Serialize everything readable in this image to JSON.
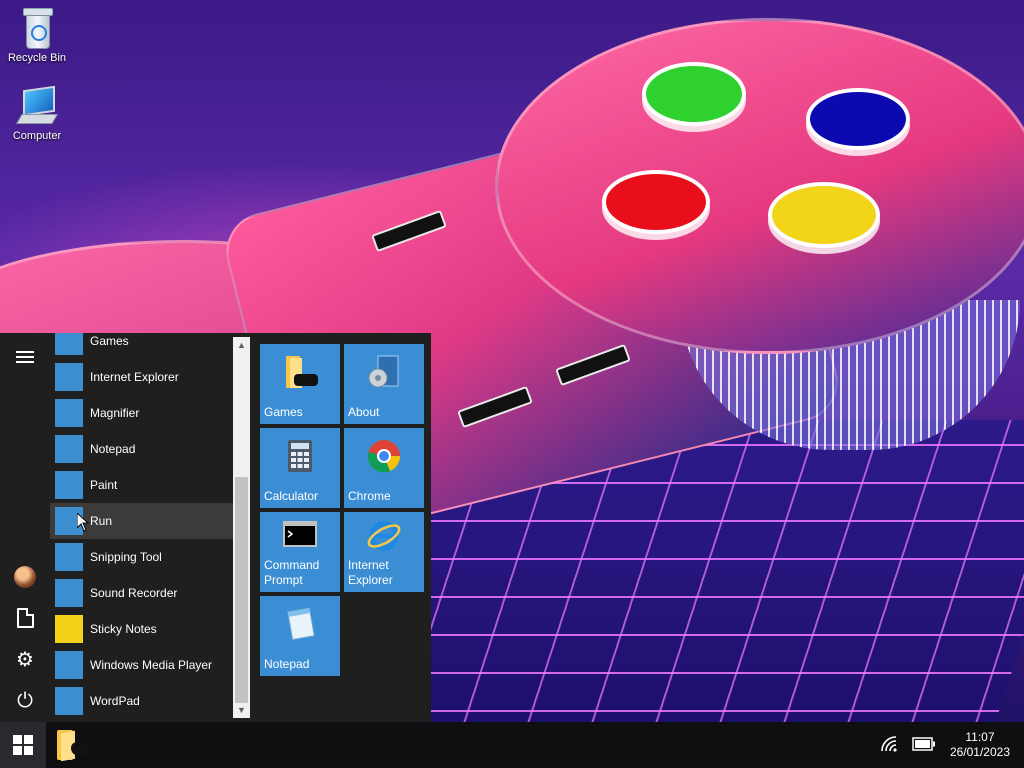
{
  "desktop": {
    "icons": [
      {
        "label": "Recycle Bin",
        "icon": "recycle-bin-icon"
      },
      {
        "label": "Computer",
        "icon": "computer-icon"
      }
    ]
  },
  "start_menu": {
    "rail": [
      {
        "name": "menu",
        "icon": "hamburger-icon"
      },
      {
        "name": "user",
        "icon": "user-avatar"
      },
      {
        "name": "documents",
        "icon": "document-icon"
      },
      {
        "name": "settings",
        "icon": "gear-icon"
      },
      {
        "name": "power",
        "icon": "power-icon"
      }
    ],
    "apps": [
      {
        "label": "Games",
        "icon": "games-folder-icon"
      },
      {
        "label": "Internet Explorer",
        "icon": "internet-explorer-icon"
      },
      {
        "label": "Magnifier",
        "icon": "magnifier-icon"
      },
      {
        "label": "Notepad",
        "icon": "notepad-icon"
      },
      {
        "label": "Paint",
        "icon": "paint-icon"
      },
      {
        "label": "Run",
        "icon": "run-icon",
        "hovered": true
      },
      {
        "label": "Snipping Tool",
        "icon": "snipping-tool-icon"
      },
      {
        "label": "Sound Recorder",
        "icon": "sound-recorder-icon"
      },
      {
        "label": "Sticky Notes",
        "icon": "sticky-notes-icon"
      },
      {
        "label": "Windows Media Player",
        "icon": "media-player-icon"
      },
      {
        "label": "WordPad",
        "icon": "wordpad-icon"
      }
    ],
    "tiles": [
      {
        "label": "Games",
        "icon": "games-folder-icon"
      },
      {
        "label": "About",
        "icon": "about-icon"
      },
      {
        "label": "Calculator",
        "icon": "calculator-icon"
      },
      {
        "label": "Chrome",
        "icon": "chrome-icon"
      },
      {
        "label": "Command\nPrompt",
        "icon": "command-prompt-icon"
      },
      {
        "label": "Internet\nExplorer",
        "icon": "internet-explorer-icon"
      },
      {
        "label": "Notepad",
        "icon": "notepad-icon"
      }
    ]
  },
  "taskbar": {
    "pinned": [
      {
        "icon": "games-folder-icon"
      }
    ],
    "tray": {
      "network_icon": "wifi-icon",
      "battery_icon": "battery-icon"
    },
    "clock": {
      "time": "11:07",
      "date": "26/01/2023"
    }
  },
  "colors": {
    "tile": "#3b8ed3",
    "start_menu_bg": "#1f1f1f",
    "taskbar_bg": "#0f0f12"
  }
}
